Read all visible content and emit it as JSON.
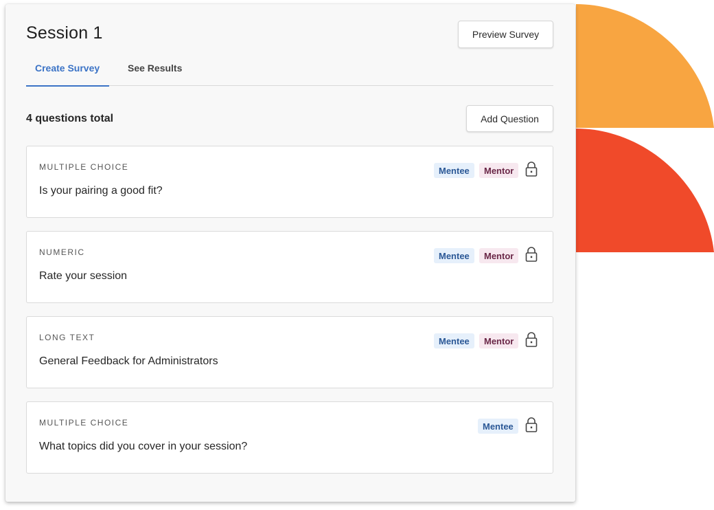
{
  "header": {
    "session_title": "Session 1",
    "preview_label": "Preview Survey"
  },
  "tabs": [
    {
      "label": "Create Survey",
      "active": true
    },
    {
      "label": "See Results",
      "active": false
    }
  ],
  "toolbar": {
    "count_label": "4 questions total",
    "add_label": "Add Question"
  },
  "questions": [
    {
      "type": "MULTIPLE CHOICE",
      "text": "Is your pairing a good fit?",
      "roles": [
        "Mentee",
        "Mentor"
      ],
      "icon": "lock-icon"
    },
    {
      "type": "NUMERIC",
      "text": "Rate your session",
      "roles": [
        "Mentee",
        "Mentor"
      ],
      "icon": "lock-icon"
    },
    {
      "type": "LONG TEXT",
      "text": "General Feedback for Administrators",
      "roles": [
        "Mentee",
        "Mentor"
      ],
      "icon": "lock-icon"
    },
    {
      "type": "MULTIPLE CHOICE",
      "text": "What topics did you cover in your session?",
      "roles": [
        "Mentee"
      ],
      "icon": "lock-icon"
    }
  ],
  "colors": {
    "accent": "#3b73c6",
    "decor_orange": "#f8a541",
    "decor_red": "#f04a2a",
    "mentee_badge_bg": "#e6f0fb",
    "mentor_badge_bg": "#f7e8ef"
  }
}
